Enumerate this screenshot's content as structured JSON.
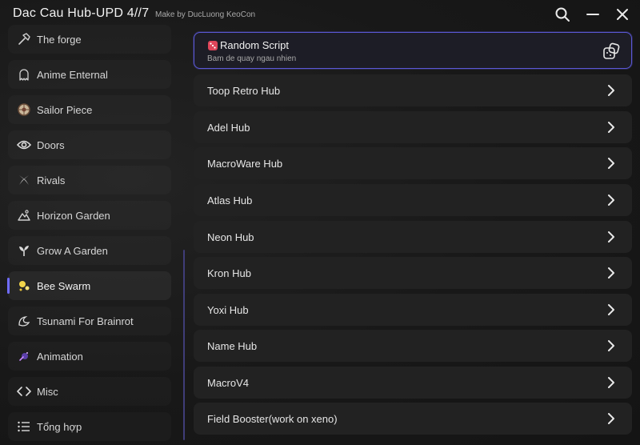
{
  "app": {
    "title": "Dac Cau Hub-UPD 4//7",
    "subtitle": "Make by DucLuong KeoCon"
  },
  "titlebar": {
    "search_icon": "search-icon",
    "minimize_icon": "minimize-icon",
    "close_icon": "close-icon"
  },
  "sidebar": {
    "items": [
      {
        "label": "The forge",
        "icon": "hammer-icon"
      },
      {
        "label": "Anime Enternal",
        "icon": "ghost-icon"
      },
      {
        "label": "Sailor Piece",
        "icon": "ship-wheel-icon"
      },
      {
        "label": "Doors",
        "icon": "eye-icon"
      },
      {
        "label": "Rivals",
        "icon": "crossed-swords-icon"
      },
      {
        "label": "Horizon Garden",
        "icon": "landscape-icon"
      },
      {
        "label": "Grow A Garden",
        "icon": "sprout-icon"
      },
      {
        "label": "Bee Swarm",
        "icon": "sparkle-icon"
      },
      {
        "label": "Tsunami For Brainrot",
        "icon": "wave-icon"
      },
      {
        "label": "Animation",
        "icon": "magic-icon"
      },
      {
        "label": "Misc",
        "icon": "code-icon"
      },
      {
        "label": "Tổng hợp",
        "icon": "list-icon"
      }
    ],
    "active_index": 7,
    "accent": "#6f6cff"
  },
  "main": {
    "featured": {
      "title": "Random Script",
      "description": "Bam de quay ngau nhien",
      "icon": "dice-icon",
      "action_icon": "open-external-icon"
    },
    "scripts": [
      "Toop Retro Hub",
      "Adel Hub",
      "MacroWare Hub",
      "Atlas Hub",
      "Neon Hub",
      "Kron Hub",
      "Yoxi Hub",
      "Name Hub",
      "MacroV4",
      "Field Booster(work on xeno)"
    ],
    "chevron_icon": "chevron-right-icon"
  },
  "colors": {
    "background": "#161616",
    "card": "#222222",
    "accent_border": "#5b58d6",
    "scroll_accent": "#3f3d78"
  }
}
